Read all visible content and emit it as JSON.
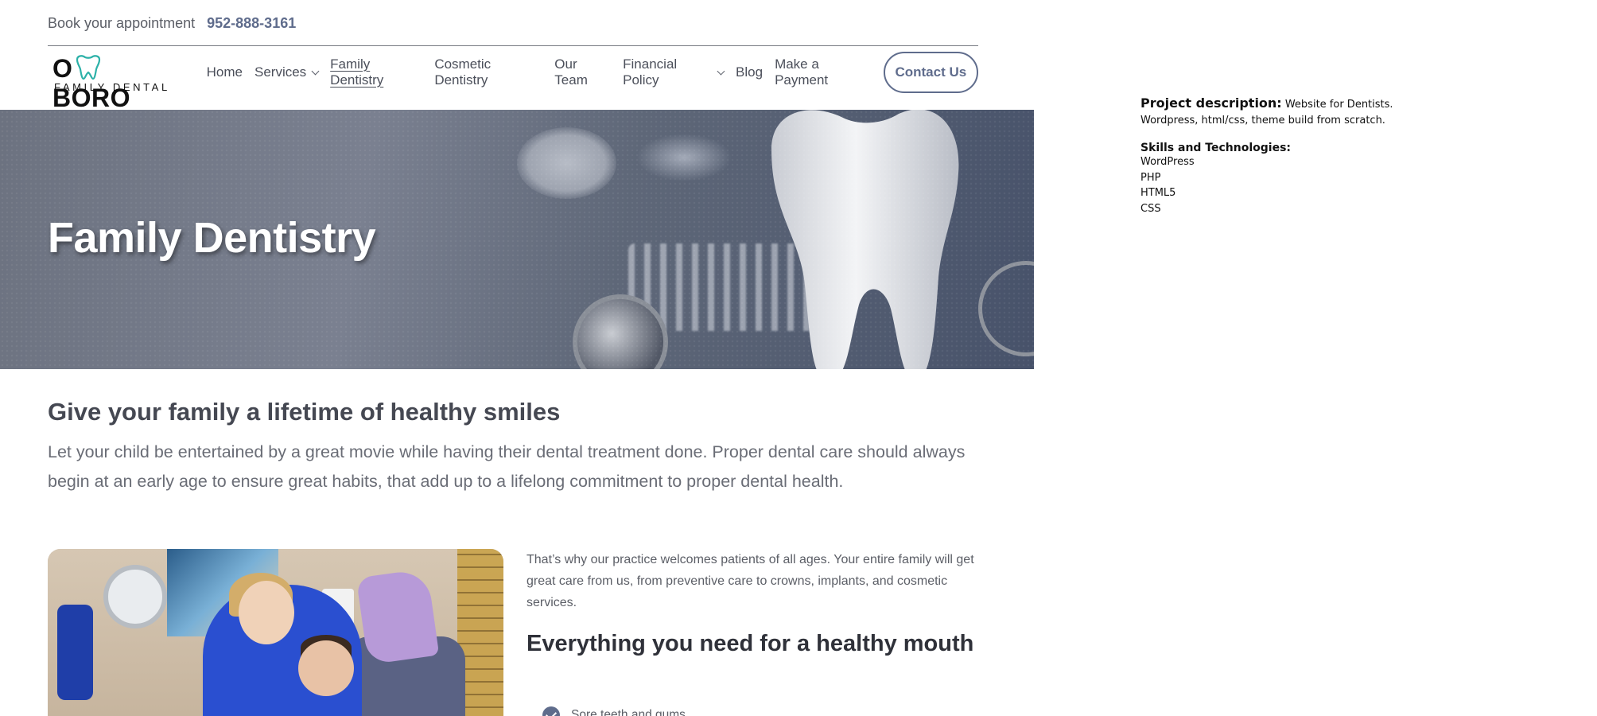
{
  "topbar": {
    "book_label": "Book your appointment",
    "phone": "952-888-3161"
  },
  "logo": {
    "wordmark_left": "O",
    "wordmark_right": "BORO",
    "subtitle": "FAMILY DENTAL"
  },
  "nav": {
    "items": [
      {
        "label": "Home"
      },
      {
        "label": "Services"
      },
      {
        "label": "Family Dentistry"
      },
      {
        "label": "Cosmetic Dentistry"
      },
      {
        "label": "Our Team"
      },
      {
        "label": "Financial Policy"
      },
      {
        "label": "Blog"
      },
      {
        "label": "Make a Payment"
      }
    ],
    "contact_label": "Contact Us"
  },
  "hero": {
    "title": "Family Dentistry"
  },
  "content": {
    "heading": "Give your family a lifetime of healthy smiles",
    "lead": "Let your child be entertained by a great movie while having their dental treatment done. Proper dental care should always begin at an early age to ensure great habits, that add up to a lifelong commitment to proper dental health.",
    "paragraph": "That’s why our practice welcomes patients of all ages. Your entire family will get great care from us, from preventive care to crowns, implants, and cosmetic services.",
    "subheading": "Everything you need for a healthy mouth",
    "list": [
      {
        "label": "Sore teeth and gums"
      }
    ]
  },
  "side_note": {
    "desc_title": "Project description:",
    "desc_text_1": "Website for Dentists.",
    "desc_text_2": "Wordpress, html/css, theme build from scratch.",
    "skills_title": "Skills and Technologies:",
    "skills": [
      "WordPress",
      "PHP",
      "HTML5",
      "CSS"
    ]
  },
  "colors": {
    "accent": "#5f6c8c",
    "hero_overlay": "#6b7384",
    "text": "#3f4148"
  }
}
